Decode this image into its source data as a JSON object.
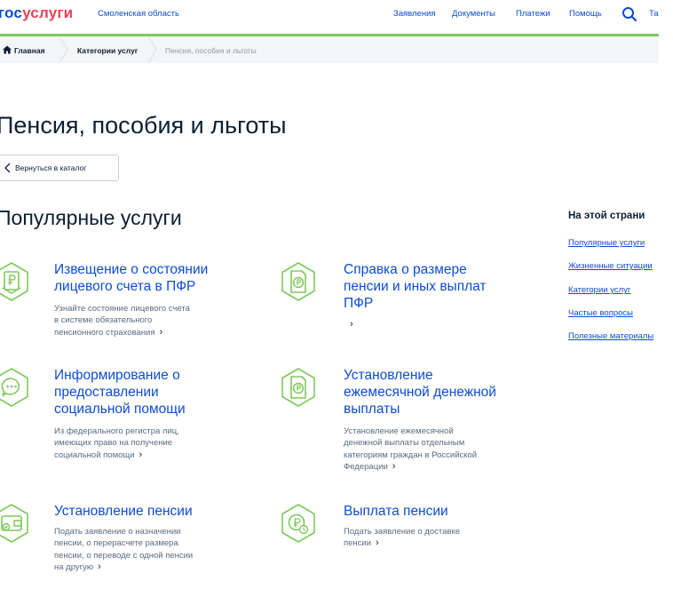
{
  "header": {
    "logo_part1": "гос",
    "logo_part2": "услуги",
    "region": "Смоленская область",
    "nav": [
      "Заявления",
      "Документы",
      "Платежи",
      "Помощь"
    ],
    "nav_cut": "Та"
  },
  "breadcrumb": {
    "home": "Главная",
    "categories": "Категории услуг",
    "current": "Пенсия, пособия и льготы"
  },
  "page": {
    "title": "Пенсия, пособия и льготы",
    "back_label": "Вернуться в каталог",
    "popular_heading": "Популярные услуги"
  },
  "services": [
    {
      "title_lines": [
        "Извещение о состоянии",
        "лицевого счета в ПФР"
      ],
      "desc_lines": [
        "Узнайте состояние лицевого счета",
        "в системе обязательного",
        "пенсионного страхования"
      ]
    },
    {
      "title_lines": [
        "Справка о размере",
        "пенсии и иных выплат",
        "ПФР"
      ],
      "desc_lines": []
    },
    {
      "title_lines": [
        "Информирование о",
        "предоставлении",
        "социальной помощи"
      ],
      "desc_lines": [
        "Из федерального регистра лиц,",
        "имеющих право на получение",
        "социальной помощи"
      ]
    },
    {
      "title_lines": [
        "Установление",
        "ежемесячной денежной",
        "выплаты"
      ],
      "desc_lines": [
        "Установление ежемесячной",
        "денежной выплаты отдельным",
        "категориям граждан в Российской",
        "Федерации"
      ]
    },
    {
      "title_lines": [
        "Установление пенсии"
      ],
      "desc_lines": [
        "Подать заявление о назначении",
        "пенсии, о перерасчете размера",
        "пенсии, о переводе с одной пенсии",
        "на другую"
      ]
    },
    {
      "title_lines": [
        "Выплата пенсии"
      ],
      "desc_lines": [
        "Подать заявление о доставке",
        "пенсии"
      ]
    }
  ],
  "toc": {
    "title": "На этой страни",
    "links": [
      "Популярные услуги",
      "Жизненные ситуации",
      "Категории услуг",
      "Частые вопросы",
      "Полезные материалы"
    ]
  },
  "colors": {
    "accent": "#0d4cd3",
    "brand_red": "#ee3f58",
    "green": "#7ec85b",
    "text": "#0b1f33",
    "muted": "#5a6b7d"
  }
}
